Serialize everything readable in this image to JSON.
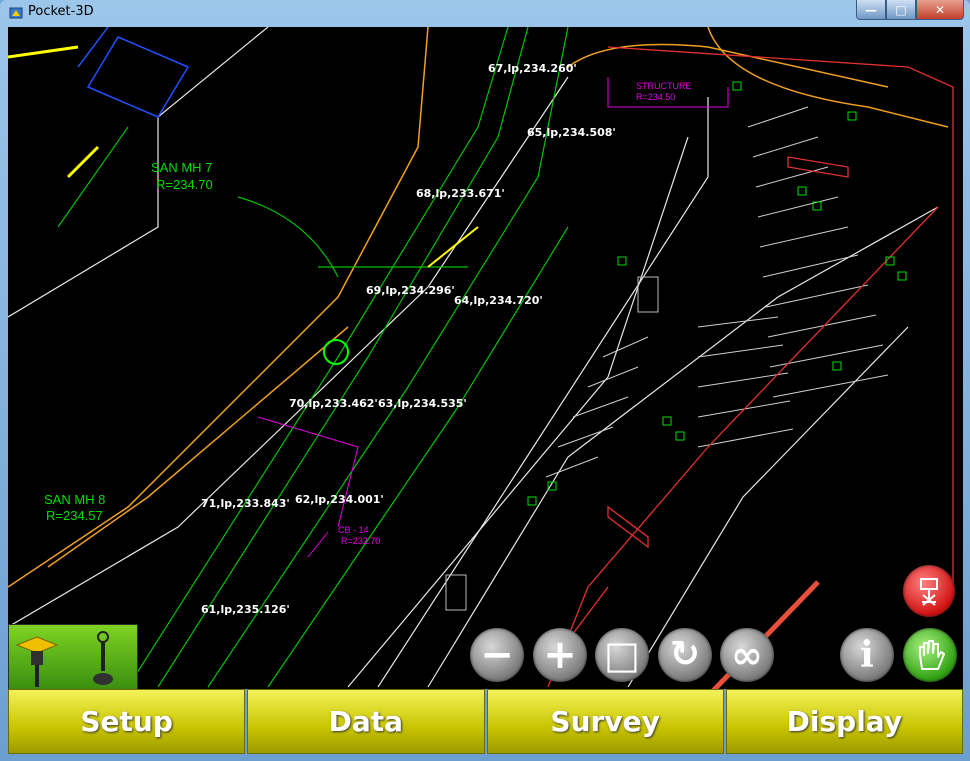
{
  "window": {
    "title": "Pocket-3D",
    "minimize": "—",
    "maximize": "□",
    "close": "✕"
  },
  "point_labels": [
    "67,lp,234.260'",
    "65,lp,234.508'",
    "68,lp,233.671'",
    "69,lp,234.296'",
    "64,lp,234.720'",
    "70,lp,233.462'",
    "63,lp,234.535'",
    "71,lp,233.843'",
    "62,lp,234.001'",
    "61,lp,235.126'"
  ],
  "cad_text": {
    "san_mh_7_line1": "SAN MH 7",
    "san_mh_7_line2": "R=234.70",
    "san_mh_8_line1": "SAN MH 8",
    "san_mh_8_line2": "R=234.57",
    "structure_line1": "STRUCTURE",
    "structure_line2": "R=234.50",
    "cb14_line1": "CB - 14",
    "cb14_line2": "R=232.70"
  },
  "map_tools": [
    {
      "name": "zoom-out-icon",
      "glyph": "−"
    },
    {
      "name": "zoom-in-icon",
      "glyph": "+"
    },
    {
      "name": "zoom-extents-icon",
      "glyph": "□"
    },
    {
      "name": "rotate-icon",
      "glyph": "↻"
    },
    {
      "name": "zoom-window-icon",
      "glyph": "∞"
    }
  ],
  "right_tools": {
    "info_glyph": "i"
  },
  "bottom_menu": [
    "Setup",
    "Data",
    "Survey",
    "Display"
  ],
  "colors": {
    "menu_yellow": "#c8c400",
    "cad_green": "#00dd00",
    "cad_magenta": "#e000e0",
    "annotation_arrow": "#e8503c"
  }
}
